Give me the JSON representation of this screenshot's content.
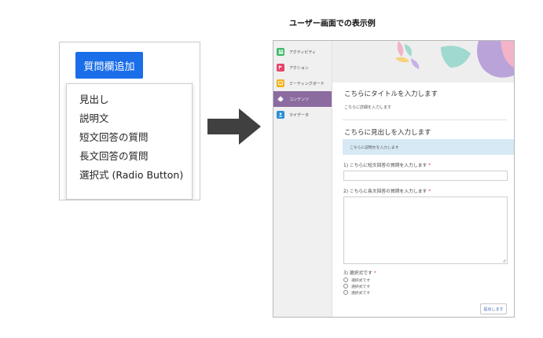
{
  "dropdown_panel": {
    "add_button_label": "質問欄追加",
    "menu_items": [
      "見出し",
      "説明文",
      "短文回答の質問",
      "長文回答の質問",
      "選択式 (Radio Button)"
    ]
  },
  "preview": {
    "caption": "ユーザー画面での表示例",
    "sidebar": {
      "items": [
        {
          "label": "アクティビティ",
          "icon": "people-icon",
          "color": "#3dbb6a",
          "active": false
        },
        {
          "label": "アクション",
          "icon": "flag-icon",
          "color": "#e8426a",
          "active": false
        },
        {
          "label": "ミーティングボード",
          "icon": "board-icon",
          "color": "#f2b31f",
          "active": false
        },
        {
          "label": "コンテンツ",
          "icon": "flower-icon",
          "color": "#8b6ba0",
          "active": true
        },
        {
          "label": "マイデータ",
          "icon": "person-icon",
          "color": "#2a8fd6",
          "active": false
        }
      ]
    },
    "content": {
      "title": "こちらにタイトルを入力します",
      "detail": "こちらに詳細を入力します",
      "heading": "こちらに見出しを入力します",
      "description": "こちらに説明文を入力します",
      "questions": {
        "short": "1) こちらに短文回答の質問を入力します",
        "long": "2) こちらに長文回答の質問を入力します",
        "choice": "3) 選択式です"
      },
      "required_mark": "*",
      "options": [
        "選択式です",
        "選択式です",
        "選択式です"
      ],
      "submit_label": "提出します"
    }
  }
}
